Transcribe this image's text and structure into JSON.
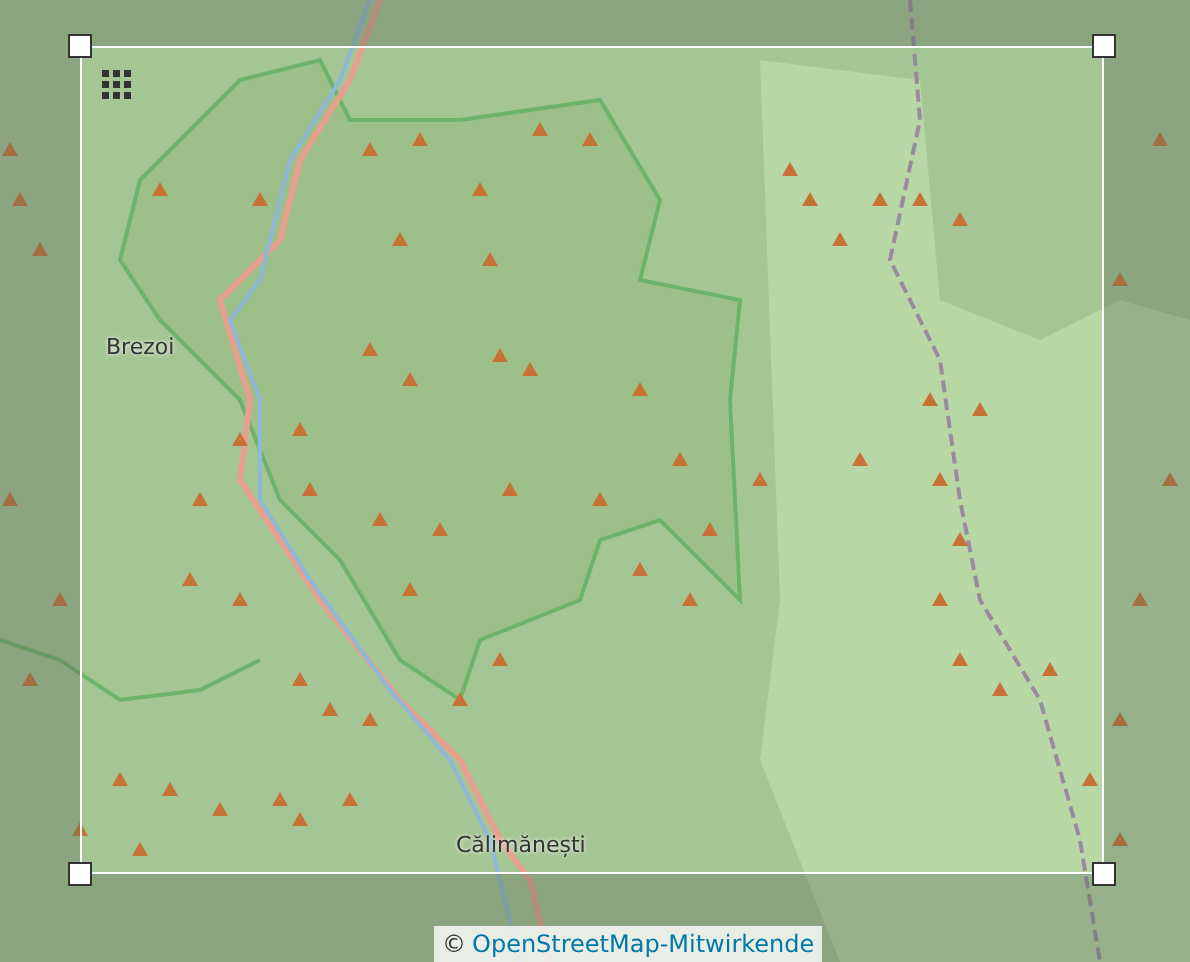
{
  "map": {
    "places": [
      {
        "name": "Brezoi",
        "kind": "town"
      },
      {
        "name": "Călimănești",
        "kind": "town"
      }
    ]
  },
  "attribution": {
    "symbol": "©",
    "link": "OpenStreetMap-Mitwirkende"
  }
}
